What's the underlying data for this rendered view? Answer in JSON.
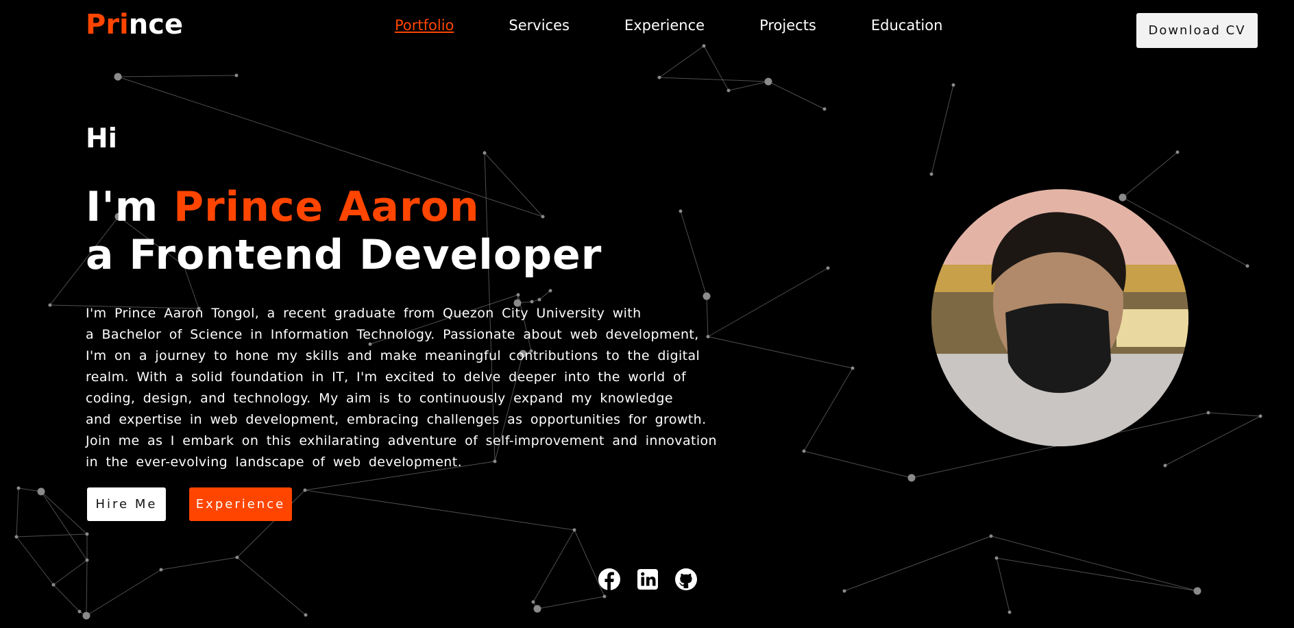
{
  "brand": {
    "logo_accent": "Pri",
    "logo_rest": "nce",
    "accent_color": "#ff4500"
  },
  "nav": {
    "items": [
      {
        "label": "Portfolio",
        "active": true
      },
      {
        "label": "Services",
        "active": false
      },
      {
        "label": "Experience",
        "active": false
      },
      {
        "label": "Projects",
        "active": false
      },
      {
        "label": "Education",
        "active": false
      }
    ]
  },
  "header": {
    "download_label": "Download CV"
  },
  "hero": {
    "greeting": "Hi",
    "intro_prefix": "I'm",
    "name": "Prince Aaron",
    "role": "a Frontend Developer",
    "bio_lines": [
      "I'm Prince Aaron Tongol, a recent graduate from Quezon City University with",
      "a Bachelor of Science in Information Technology. Passionate about web development,",
      "I'm on a journey to hone my skills and make meaningful contributions to the digital",
      "realm. With a solid foundation in IT, I'm excited to delve deeper into the world of",
      "coding, design, and technology. My aim is to continuously expand my knowledge",
      "and expertise in web development, embracing challenges as opportunities for growth.",
      "Join me as I embark on this exhilarating adventure of self-improvement and innovation",
      "in the ever-evolving landscape of web development."
    ],
    "hire_label": "Hire Me",
    "experience_label": "Experience"
  },
  "social": {
    "icons": [
      "facebook-icon",
      "linkedin-icon",
      "github-icon"
    ]
  }
}
